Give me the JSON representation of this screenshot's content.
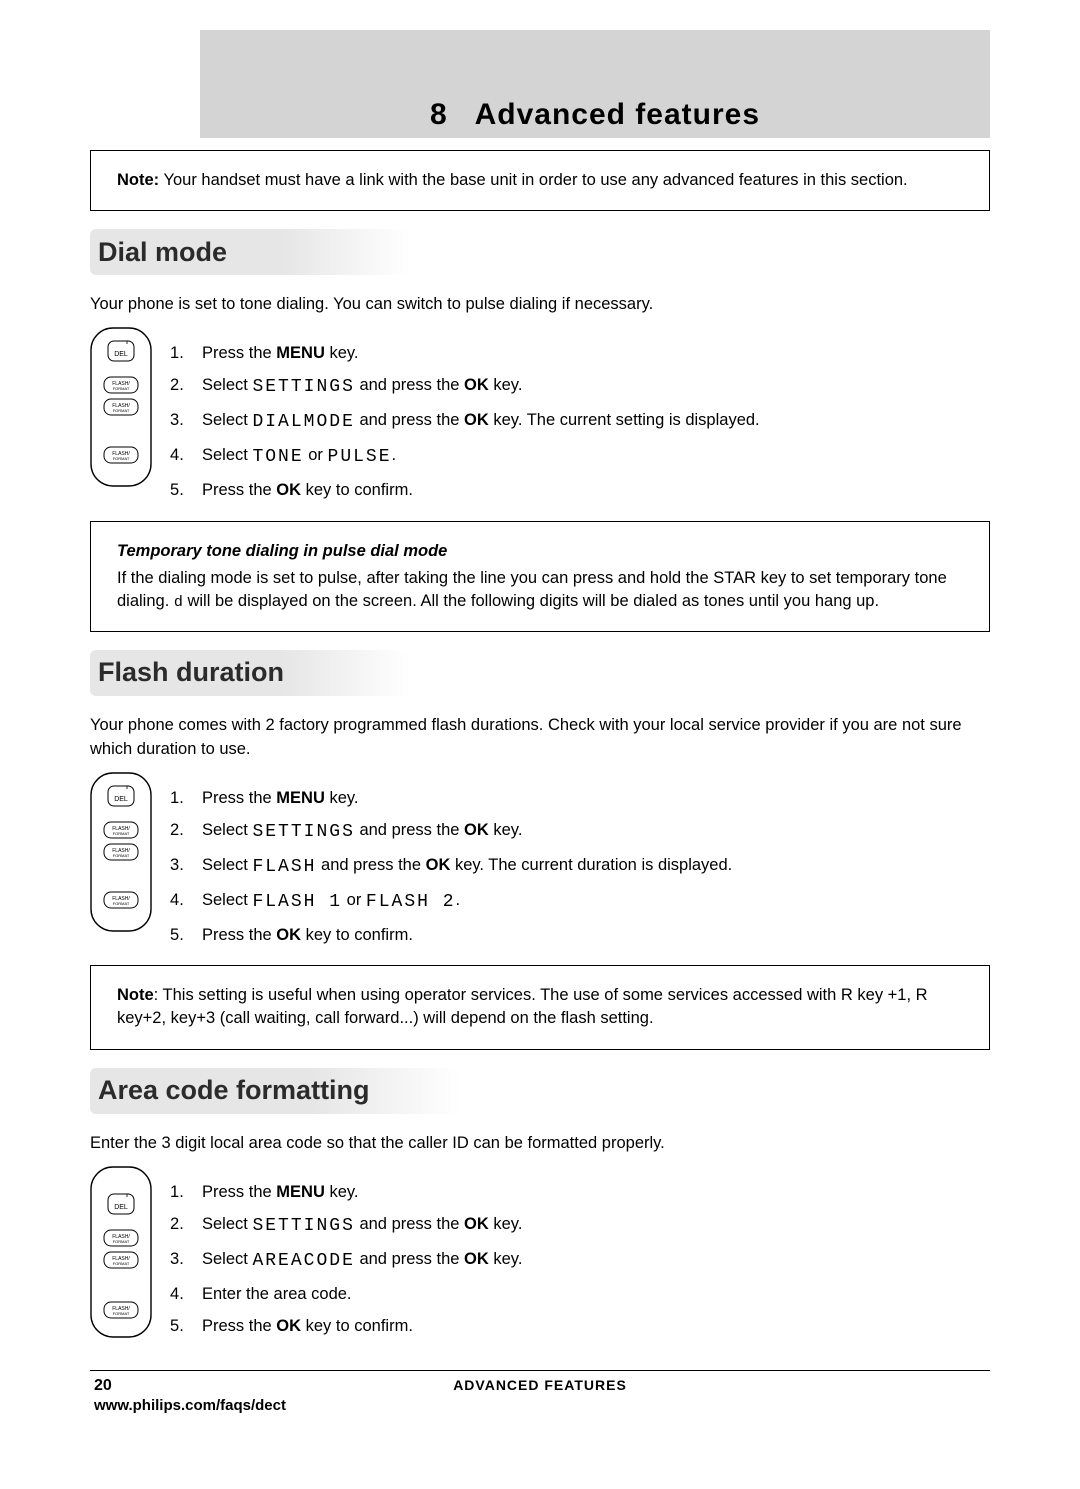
{
  "chapter": {
    "number": "8",
    "title": "Advanced features"
  },
  "top_note": "Your handset must have a link with the base unit in order to use any advanced features in this section.",
  "section1": {
    "heading": "Dial mode",
    "intro": "Your phone is set to tone dialing.  You can switch to pulse dialing if necessary.",
    "steps": {
      "s1_pre": "Press the ",
      "s1_key": "MENU",
      "s1_post": " key.",
      "s2_pre": "Select ",
      "s2_lcd": "SETTINGS",
      "s2_mid": " and press the ",
      "s2_key": "OK",
      "s2_post": " key.",
      "s3_pre": "Select ",
      "s3_lcd": "DIALMODE",
      "s3_mid": " and press the ",
      "s3_key": "OK",
      "s3_post": " key. The current setting is displayed.",
      "s4_pre": "Select ",
      "s4_lcd1": "TONE",
      "s4_or": " or ",
      "s4_lcd2": "PULSE",
      "s4_post": ".",
      "s5_pre": "Press the ",
      "s5_key": "OK",
      "s5_post": " key to confirm."
    },
    "tip_heading": "Temporary tone dialing in pulse dial mode",
    "tip_body_a": "If the dialing mode is set to pulse, after taking the line you can press and hold the ",
    "tip_key": "STAR",
    "tip_body_b": " key to set temporary tone dialing.  ",
    "tip_glyph": "d",
    "tip_body_c": " will be displayed on the screen.  All the following digits will be dialed as tones until you hang up."
  },
  "section2": {
    "heading": "Flash duration",
    "intro": "Your phone comes with 2 factory programmed flash durations.  Check with your local service provider if you are not sure which duration to use.",
    "steps": {
      "s1_pre": "Press the ",
      "s1_key": "MENU",
      "s1_post": " key.",
      "s2_pre": "Select ",
      "s2_lcd": "SETTINGS",
      "s2_mid": " and press the ",
      "s2_key": "OK",
      "s2_post": " key.",
      "s3_pre": "Select ",
      "s3_lcd": "FLASH",
      "s3_mid": " and press the ",
      "s3_key": "OK",
      "s3_post": " key. The current duration is displayed.",
      "s4_pre": "Select ",
      "s4_lcd1": "FLASH 1",
      "s4_or": " or ",
      "s4_lcd2": "FLASH 2",
      "s4_post": ".",
      "s5_pre": "Press the ",
      "s5_key": "OK",
      "s5_post": " key to confirm."
    },
    "note_text": ": This setting is useful when using operator services.  The use of some services accessed with R key +1, R key+2, key+3 (call waiting, call forward...) will depend on the flash setting."
  },
  "section3": {
    "heading": "Area code formatting",
    "intro": "Enter the 3 digit local area code so that the caller ID can be formatted properly.",
    "steps": {
      "s1_pre": "Press the ",
      "s1_key": "MENU",
      "s1_post": " key.",
      "s2_pre": "Select ",
      "s2_lcd": "SETTINGS",
      "s2_mid": " and press the ",
      "s2_key": "OK",
      "s2_post": " key.",
      "s3_pre": "Select ",
      "s3_lcd": "AREACODE",
      "s3_mid": " and press the ",
      "s3_key": "OK",
      "s3_post": " key.",
      "s4": "Enter the area code.",
      "s5_pre": "Press the ",
      "s5_key": "OK",
      "s5_post": " key to confirm."
    }
  },
  "footer": {
    "page_number": "20",
    "chapter_label": "Advanced Features",
    "url": "www.philips.com/faqs/dect"
  },
  "labels": {
    "note": "Note",
    "note_colon": "Note:"
  }
}
